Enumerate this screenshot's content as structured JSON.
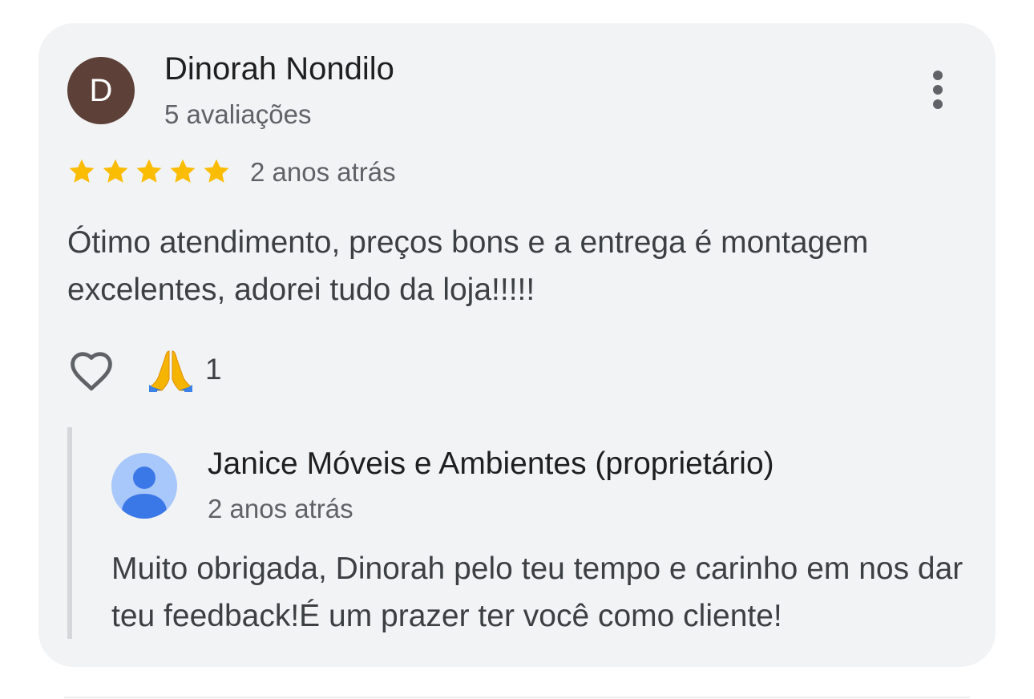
{
  "colors": {
    "card_background": "#f2f3f5",
    "avatar_background": "#5d4037",
    "star": "#fbbc04",
    "owner_avatar_background": "#a8c7fa",
    "owner_avatar_figure": "#3b78e7"
  },
  "review": {
    "author_initial": "D",
    "author_name": "Dinorah Nondilo",
    "author_meta": "5 avaliações",
    "rating": 5,
    "rating_max": 5,
    "date": "2 anos atrás",
    "text": "Ótimo atendimento, preços bons e a entrega é montagem excelentes, adorei tudo da loja!!!!!",
    "more_icon": "more-vert-icon",
    "like_icon": "heart-outline-icon",
    "reaction_emoji": "🙏",
    "reaction_count": "1"
  },
  "reply": {
    "avatar_icon": "person-icon",
    "owner_name": "Janice Móveis e Ambientes (proprietário)",
    "date": "2 anos atrás",
    "text": "Muito obrigada, Dinorah pelo teu tempo e carinho em nos dar teu feedback!É um prazer ter você como cliente!"
  }
}
